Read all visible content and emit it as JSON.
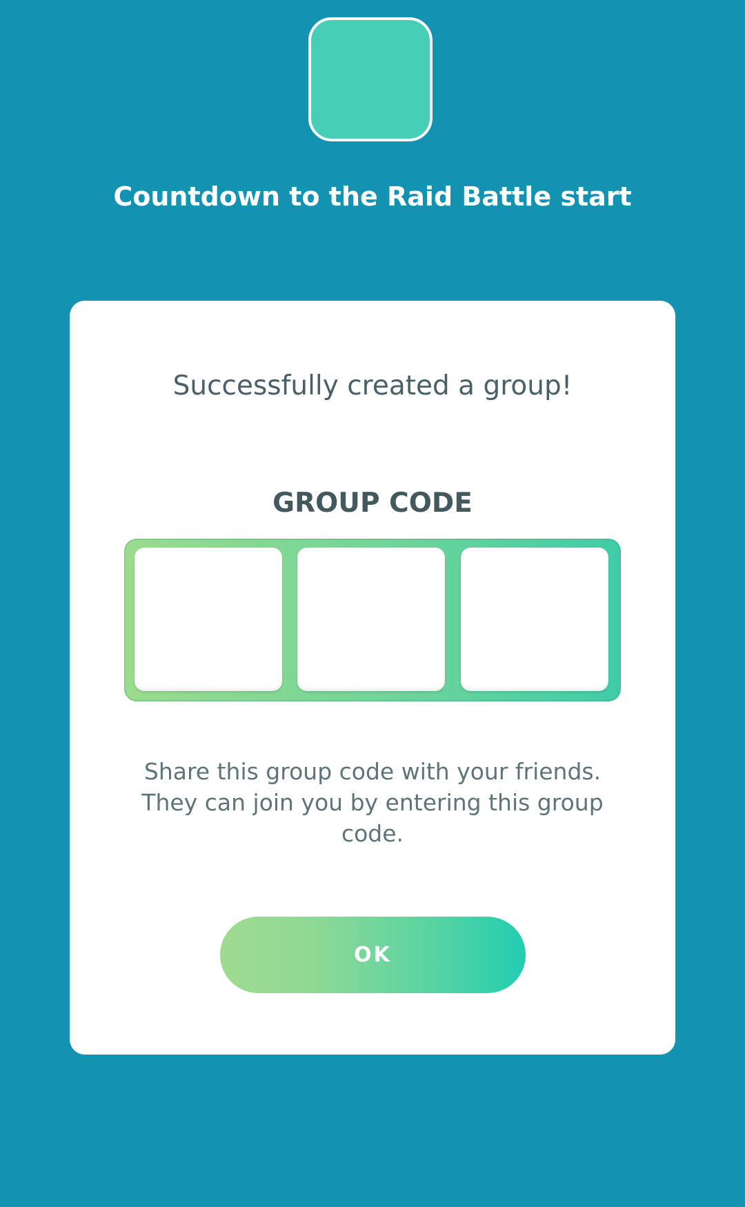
{
  "header": {
    "title": "Countdown to the Raid Battle start"
  },
  "dialog": {
    "message": "Successfully created a group!",
    "code_heading": "GROUP CODE",
    "instructions": "Share this group code with your friends. They can join you by entering this group code.",
    "ok_label": "OK"
  },
  "colors": {
    "background": "#1392b2",
    "timer_tile": "#46cfb6",
    "button_gradient_start": "#a0da92",
    "button_gradient_end": "#22cdb1"
  }
}
